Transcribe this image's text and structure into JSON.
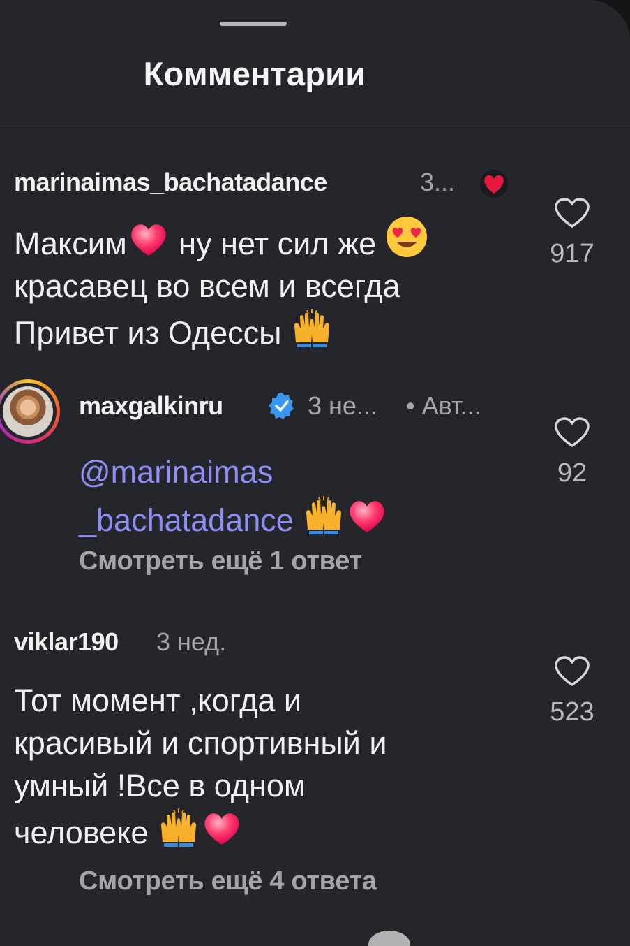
{
  "header": {
    "title": "Комментарии"
  },
  "comments": [
    {
      "username": "marinaimas_bachatadance",
      "time": "3...",
      "text_line1_a": "Максим",
      "text_line1_b": " ну нет сил же ",
      "text_line2": "красавец во всем и всегда",
      "text_line3": "Привет из Одессы ",
      "likes": "917",
      "author_liked": true
    },
    {
      "username": "maxgalkinru",
      "verified": true,
      "time": "3 не...",
      "author_badge": "• Авт...",
      "mention_line1": "@marinaimas",
      "mention_line2": "_bachatadance",
      "likes": "92",
      "more_replies": "Смотреть ещё 1 ответ"
    },
    {
      "username": "viklar190",
      "time": "3 нед.",
      "text_line1": "Тот момент ,когда и",
      "text_line2": "красивый и спортивный и",
      "text_line3": "умный !Все в одном",
      "text_line4": "человеке ",
      "likes": "523",
      "more_replies": "Смотреть ещё 4 ответа"
    }
  ],
  "icons": {
    "like": "heart-outline-icon",
    "verified": "verified-badge-icon",
    "author_like": "red-heart-icon"
  },
  "colors": {
    "background": "#25262b",
    "mention": "#8f8ef5",
    "muted": "#a5a6ab",
    "heart_red": "#e8173d"
  }
}
